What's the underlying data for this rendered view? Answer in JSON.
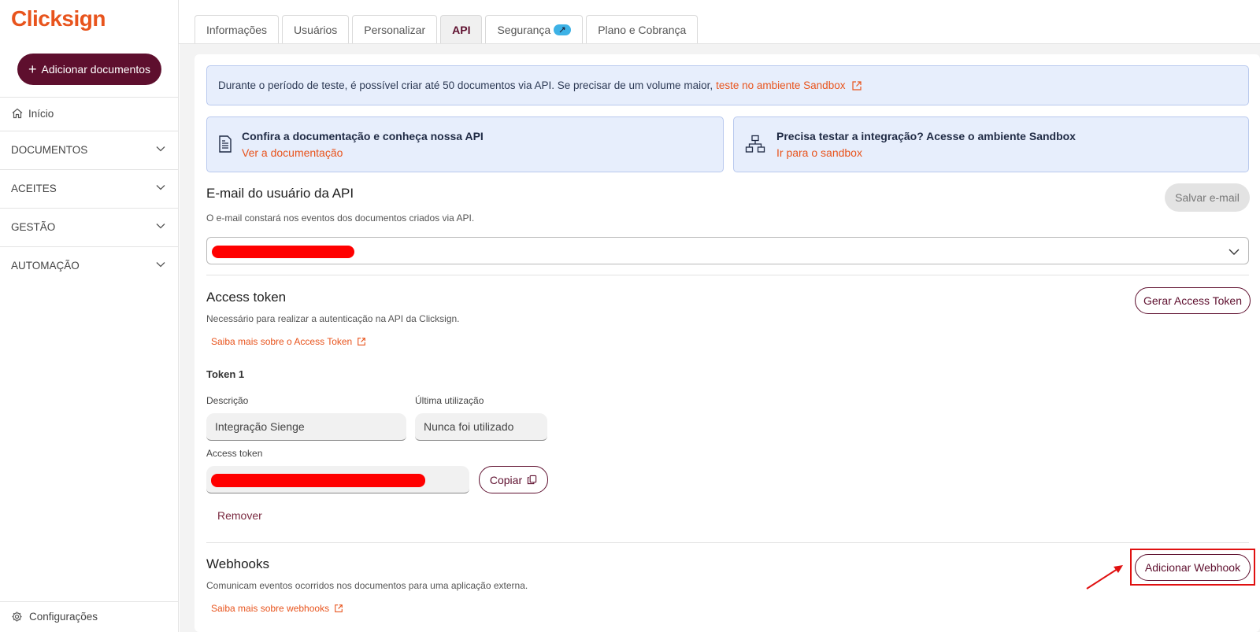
{
  "brand": {
    "name": "Clicksign",
    "color": "#e8541d"
  },
  "sidebar": {
    "add_button": "Adicionar documentos",
    "home": "Início",
    "items": [
      {
        "label": "DOCUMENTOS"
      },
      {
        "label": "ACEITES"
      },
      {
        "label": "GESTÃO"
      },
      {
        "label": "AUTOMAÇÃO"
      }
    ],
    "config": "Configurações"
  },
  "tabs": [
    {
      "label": "Informações"
    },
    {
      "label": "Usuários"
    },
    {
      "label": "Personalizar"
    },
    {
      "label": "API",
      "active": true
    },
    {
      "label": "Segurança"
    },
    {
      "label": "Plano e Cobrança"
    }
  ],
  "banner": {
    "text": "Durante o período de teste, é possível criar até 50 documentos via API. Se precisar de um volume maior,",
    "link": "teste no ambiente Sandbox"
  },
  "doc_cards": [
    {
      "title": "Confira a documentação e conheça nossa API",
      "link": "Ver a documentação",
      "icon": "document-icon"
    },
    {
      "title": "Precisa testar a integração? Acesse o ambiente Sandbox",
      "link": "Ir para o sandbox",
      "icon": "network-icon"
    }
  ],
  "email_section": {
    "title": "E-mail do usuário da API",
    "subtitle": "O e-mail constará nos eventos dos documentos criados via API.",
    "save_button": "Salvar e-mail"
  },
  "token_section": {
    "title": "Access token",
    "subtitle": "Necessário para realizar a autenticação na API da Clicksign.",
    "learn_more": "Saiba mais sobre o Access Token",
    "generate_button": "Gerar Access Token",
    "token_name": "Token 1",
    "description_label": "Descrição",
    "description_value": "Integração Sienge",
    "last_used_label": "Última utilização",
    "last_used_value": "Nunca foi utilizado",
    "access_token_label": "Access token",
    "copy_button": "Copiar",
    "remove": "Remover"
  },
  "webhooks_section": {
    "title": "Webhooks",
    "subtitle": "Comunicam eventos ocorridos nos documentos para uma aplicação externa.",
    "learn_more": "Saiba mais sobre webhooks",
    "add_button": "Adicionar Webhook"
  }
}
